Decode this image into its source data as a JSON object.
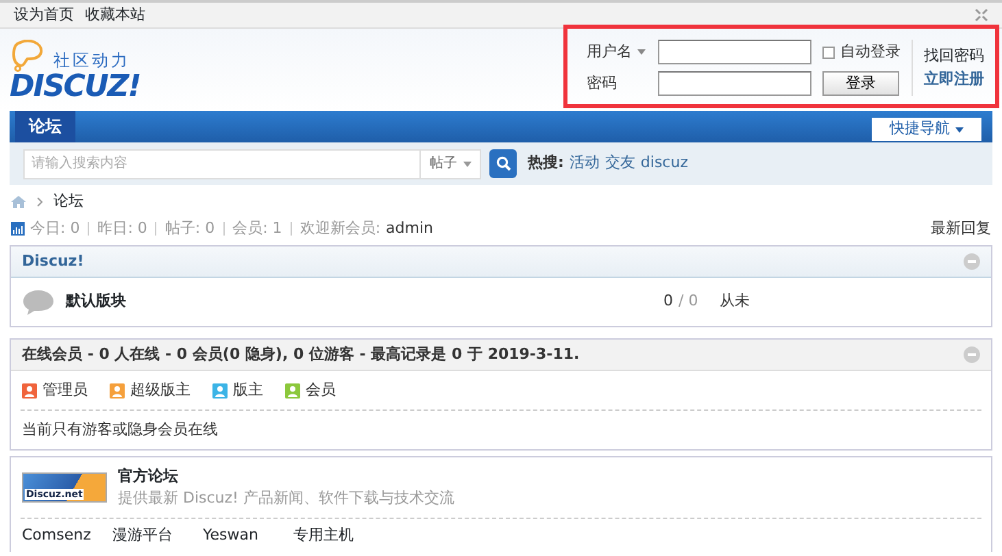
{
  "topbar": {
    "links": [
      "设为首页",
      "收藏本站"
    ]
  },
  "logo": {
    "tagline": "社区动力",
    "wordmark": "DISCUZ!"
  },
  "login": {
    "highlighted": true,
    "username_label": "用户名",
    "password_label": "密码",
    "auto_login": {
      "label": "自动登录",
      "checked": false
    },
    "submit": "登录",
    "links": [
      "找回密码",
      "立即注册"
    ]
  },
  "nav": {
    "tabs": [
      {
        "label": "论坛",
        "selected": true
      }
    ],
    "quick_nav": "快捷导航"
  },
  "search": {
    "placeholder": "请输入搜索内容",
    "type": "帖子",
    "hot_label": "热搜:",
    "hot": [
      "活动",
      "交友",
      "discuz"
    ]
  },
  "breadcrumb": [
    "论坛"
  ],
  "stats": {
    "items": [
      "今日: 0",
      "昨日: 0",
      "帖子: 0",
      "会员: 1"
    ],
    "welcome": "欢迎新会员:",
    "new_member": "admin",
    "latest_reply": "最新回复"
  },
  "category": {
    "title": "Discuz!",
    "expanded": true,
    "forums": [
      {
        "name": "默认版块",
        "threads": "0",
        "posts": "/ 0",
        "last": "从未"
      }
    ]
  },
  "online": {
    "title": "在线会员 - 0 人在线 - 0 会员(0 隐身), 0 位游客 - 最高记录是 0 于 2019-3-11.",
    "expanded": true,
    "legend": [
      {
        "label": "管理员",
        "color": "#f0643c"
      },
      {
        "label": "超级版主",
        "color": "#f5a03c"
      },
      {
        "label": "版主",
        "color": "#3cb4e6"
      },
      {
        "label": "会员",
        "color": "#8cc83c"
      }
    ],
    "note": "当前只有游客或隐身会员在线"
  },
  "links": {
    "featured": {
      "banner": "Discuz.net",
      "title": "官方论坛",
      "description": "提供最新 Discuz! 产品新闻、软件下载与技术交流"
    },
    "text_links": [
      "Comsenz",
      "漫游平台",
      "Yeswan",
      "专用主机"
    ]
  }
}
